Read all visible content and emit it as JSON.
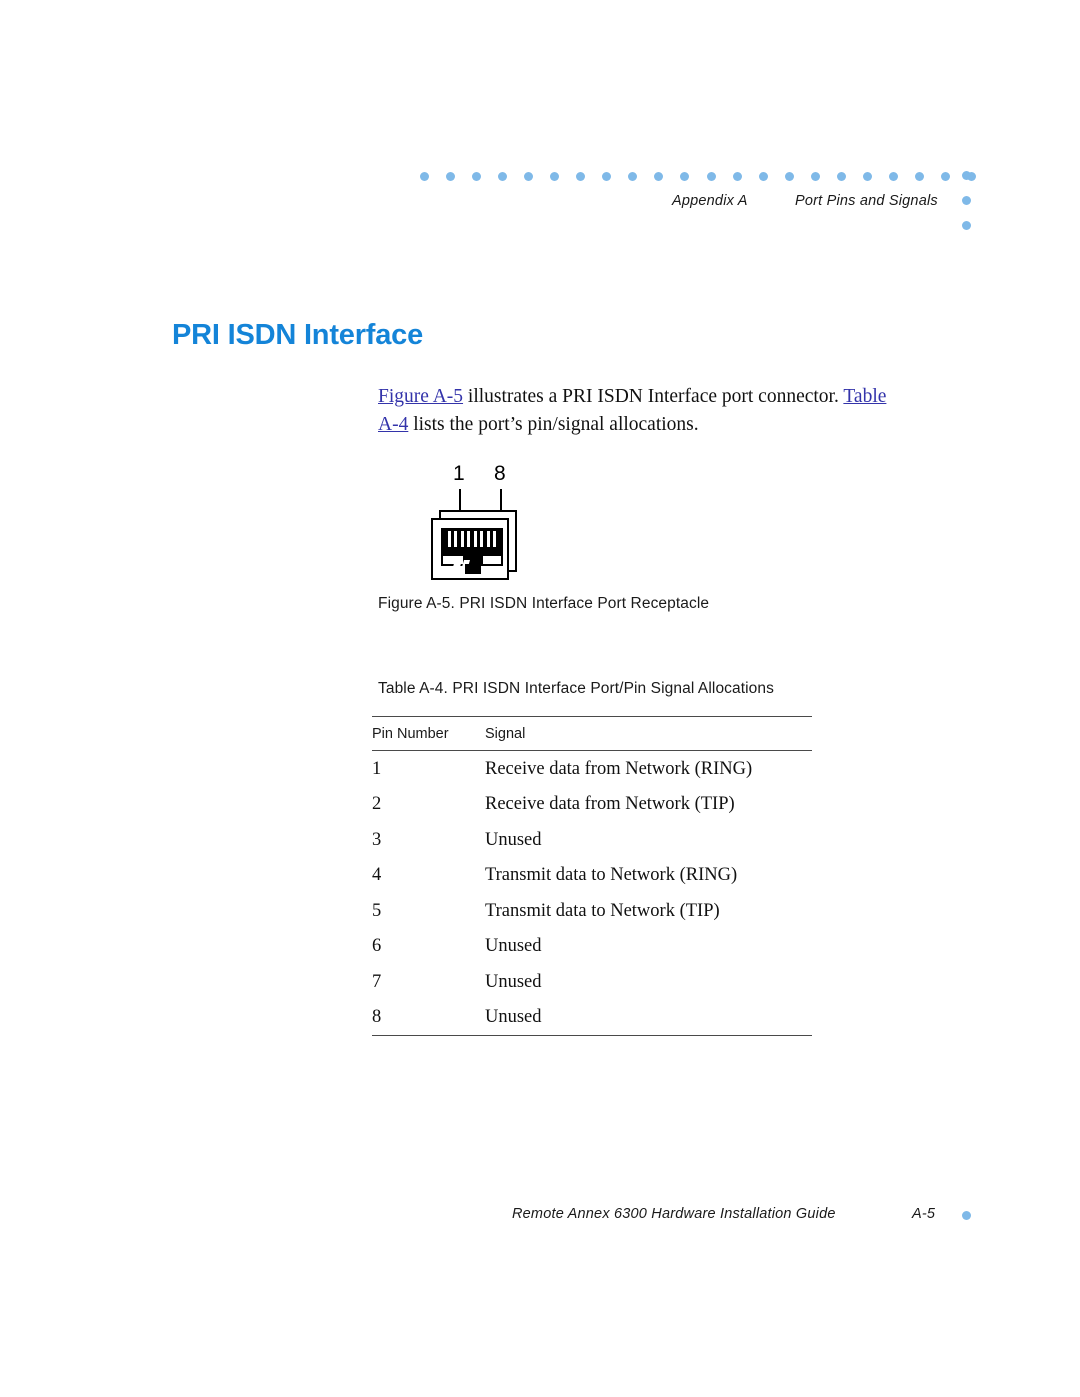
{
  "header": {
    "appendix": "Appendix A",
    "section": "Port Pins and Signals",
    "rule_dot_count": 22,
    "corner_dot_count": 3,
    "dot_color": "#7fb9e8"
  },
  "title": {
    "text": "PRI ISDN Interface",
    "color": "#1484d8"
  },
  "intro": {
    "link1": "Figure A-5",
    "text1": " illustrates a PRI ISDN Interface port connector. ",
    "link2": "Table A-4",
    "text2": " lists the port’s pin/signal allocations.",
    "link_color": "#3333aa"
  },
  "figure": {
    "pin_first_label": "1",
    "pin_last_label": "8",
    "contact_count": 8,
    "caption": "Figure A-5. PRI ISDN Interface Port Receptacle"
  },
  "table": {
    "caption": "Table A-4. PRI ISDN Interface Port/Pin Signal Allocations",
    "columns": [
      "Pin Number",
      "Signal"
    ],
    "rows": [
      {
        "pin": "1",
        "signal": "Receive data from Network (RING)"
      },
      {
        "pin": "2",
        "signal": "Receive data from Network (TIP)"
      },
      {
        "pin": "3",
        "signal": "Unused"
      },
      {
        "pin": "4",
        "signal": "Transmit data to Network (RING)"
      },
      {
        "pin": "5",
        "signal": "Transmit data to Network (TIP)"
      },
      {
        "pin": "6",
        "signal": "Unused"
      },
      {
        "pin": "7",
        "signal": "Unused"
      },
      {
        "pin": "8",
        "signal": "Unused"
      }
    ]
  },
  "footer": {
    "title": "Remote Annex 6300 Hardware Installation Guide",
    "page": "A-5"
  }
}
